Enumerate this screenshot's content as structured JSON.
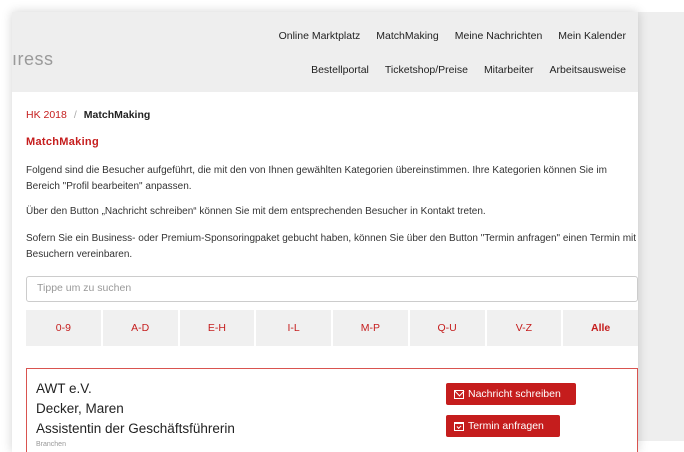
{
  "header": {
    "logo_text": "ıress",
    "nav_row1": [
      "Online Marktplatz",
      "MatchMaking",
      "Meine Nachrichten",
      "Mein Kalender"
    ],
    "nav_row2": [
      "Bestellportal",
      "Ticketshop/Preise",
      "Mitarbeiter",
      "Arbeitsausweise"
    ]
  },
  "breadcrumb": {
    "parent": "HK 2018",
    "separator": "/",
    "current": "MatchMaking"
  },
  "page_title": "MatchMaking",
  "paragraphs": [
    "Folgend sind die Besucher aufgeführt, die mit den von Ihnen gewählten Kategorien übereinstimmen. Ihre Kategorien können Sie im Bereich \"Profil bearbeiten\" anpassen.",
    "Über den Button „Nachricht schreiben“ können Sie mit dem entsprechenden Besucher in Kontakt treten.",
    "Sofern Sie ein Business- oder Premium-Sponsoringpaket gebucht haben, können Sie über den Button \"Termin anfragen\" einen Termin mit Besuchern vereinbaren."
  ],
  "search": {
    "placeholder": "Tippe um zu suchen",
    "value": ""
  },
  "filters": [
    {
      "label": "0-9"
    },
    {
      "label": "A-D"
    },
    {
      "label": "E-H"
    },
    {
      "label": "I-L"
    },
    {
      "label": "M-P"
    },
    {
      "label": "Q-U"
    },
    {
      "label": "V-Z"
    },
    {
      "label": "Alle",
      "active": true
    }
  ],
  "visitor_card": {
    "company": "AWT e.V.",
    "name": "Decker, Maren",
    "position": "Assistentin der Geschäftsführerin",
    "sub_label": "Branchen",
    "message_button": "Nachricht schreiben",
    "appointment_button": "Termin anfragen",
    "message_icon": "envelope-icon",
    "appointment_icon": "calendar-check-icon"
  },
  "colors": {
    "accent": "#c51d1d",
    "header_bg": "#eeeeee",
    "filter_bg": "#f0f0f0",
    "card_border": "#d9534f"
  }
}
